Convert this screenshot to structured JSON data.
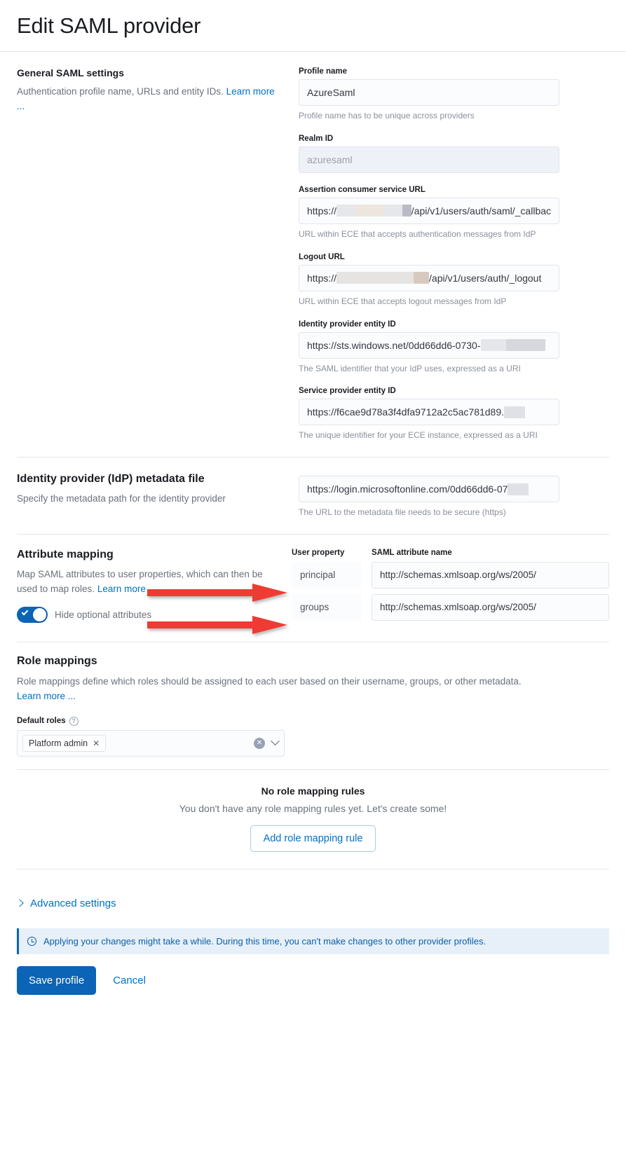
{
  "page": {
    "title": "Edit SAML provider"
  },
  "general": {
    "heading": "General SAML settings",
    "description": "Authentication profile name, URLs and entity IDs. ",
    "learn_more": "Learn more ...",
    "fields": {
      "profile_name": {
        "label": "Profile name",
        "value": "AzureSaml",
        "help": "Profile name has to be unique across providers"
      },
      "realm_id": {
        "label": "Realm ID",
        "value": "azuresaml",
        "help": ""
      },
      "acs_url": {
        "label": "Assertion consumer service URL",
        "prefix": "https://",
        "suffix": "/api/v1/users/auth/saml/_callbac",
        "help": "URL within ECE that accepts authentication messages from IdP"
      },
      "logout_url": {
        "label": "Logout URL",
        "prefix": "https://",
        "suffix": "/api/v1/users/auth/_logout",
        "help": "URL within ECE that accepts logout messages from IdP"
      },
      "idp_entity_id": {
        "label": "Identity provider entity ID",
        "value": "https://sts.windows.net/0dd66dd6-0730-",
        "help": "The SAML identifier that your IdP uses, expressed as a URI"
      },
      "sp_entity_id": {
        "label": "Service provider entity ID",
        "value": "https://f6cae9d78a3f4dfa9712a2c5ac781d89.",
        "help": "The unique identifier for your ECE instance, expressed as a URI"
      }
    }
  },
  "metadata": {
    "heading": "Identity provider (IdP) metadata file",
    "description": "Specify the metadata path for the identity provider",
    "value": "https://login.microsoftonline.com/0dd66dd6-07",
    "help": "The URL to the metadata file needs to be secure (https)"
  },
  "attribute_mapping": {
    "heading": "Attribute mapping",
    "description": "Map SAML attributes to user properties, which can then be used to map roles. ",
    "learn_more": "Learn more ...",
    "toggle_label": "Hide optional attributes",
    "toggle_on": true,
    "columns": {
      "user_property": "User property",
      "saml_attribute_name": "SAML attribute name"
    },
    "rows": [
      {
        "user_property": "principal",
        "saml_attribute_name": "http://schemas.xmlsoap.org/ws/2005/"
      },
      {
        "user_property": "groups",
        "saml_attribute_name": "http://schemas.xmlsoap.org/ws/2005/"
      }
    ]
  },
  "role_mappings": {
    "heading": "Role mappings",
    "description": "Role mappings define which roles should be assigned to each user based on their username, groups, or other metadata.",
    "learn_more": "Learn more ...",
    "default_roles_label": "Default roles",
    "selected_roles": [
      {
        "label": "Platform admin",
        "remove": "✕"
      }
    ],
    "empty_title": "No role mapping rules",
    "empty_subtitle": "You don't have any role mapping rules yet. Let's create some!",
    "add_rule_button": "Add role mapping rule"
  },
  "advanced": {
    "label": "Advanced settings"
  },
  "callout": {
    "text": "Applying your changes might take a while. During this time, you can't make changes to other provider profiles."
  },
  "footer": {
    "save_label": "Save profile",
    "cancel_label": "Cancel"
  },
  "colors": {
    "primary": "#0b64b5",
    "link": "#0071c2",
    "arrow": "#ee3b33",
    "callout_bg": "#e7f0f8"
  }
}
